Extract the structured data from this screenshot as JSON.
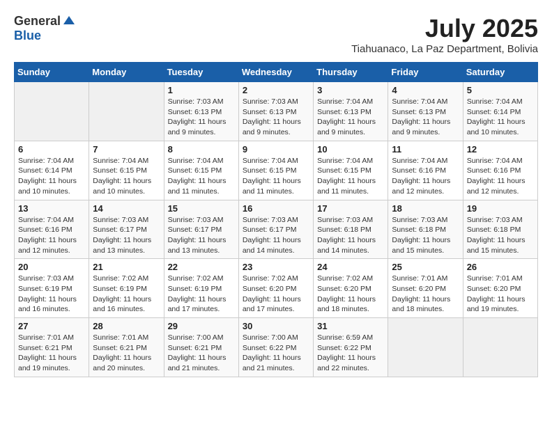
{
  "logo": {
    "general": "General",
    "blue": "Blue"
  },
  "title": {
    "month": "July 2025",
    "location": "Tiahuanaco, La Paz Department, Bolivia"
  },
  "headers": [
    "Sunday",
    "Monday",
    "Tuesday",
    "Wednesday",
    "Thursday",
    "Friday",
    "Saturday"
  ],
  "weeks": [
    [
      {
        "day": "",
        "empty": true
      },
      {
        "day": "",
        "empty": true
      },
      {
        "day": "1",
        "sunrise": "7:03 AM",
        "sunset": "6:13 PM",
        "daylight": "11 hours and 9 minutes."
      },
      {
        "day": "2",
        "sunrise": "7:03 AM",
        "sunset": "6:13 PM",
        "daylight": "11 hours and 9 minutes."
      },
      {
        "day": "3",
        "sunrise": "7:04 AM",
        "sunset": "6:13 PM",
        "daylight": "11 hours and 9 minutes."
      },
      {
        "day": "4",
        "sunrise": "7:04 AM",
        "sunset": "6:13 PM",
        "daylight": "11 hours and 9 minutes."
      },
      {
        "day": "5",
        "sunrise": "7:04 AM",
        "sunset": "6:14 PM",
        "daylight": "11 hours and 10 minutes."
      }
    ],
    [
      {
        "day": "6",
        "sunrise": "7:04 AM",
        "sunset": "6:14 PM",
        "daylight": "11 hours and 10 minutes."
      },
      {
        "day": "7",
        "sunrise": "7:04 AM",
        "sunset": "6:15 PM",
        "daylight": "11 hours and 10 minutes."
      },
      {
        "day": "8",
        "sunrise": "7:04 AM",
        "sunset": "6:15 PM",
        "daylight": "11 hours and 11 minutes."
      },
      {
        "day": "9",
        "sunrise": "7:04 AM",
        "sunset": "6:15 PM",
        "daylight": "11 hours and 11 minutes."
      },
      {
        "day": "10",
        "sunrise": "7:04 AM",
        "sunset": "6:15 PM",
        "daylight": "11 hours and 11 minutes."
      },
      {
        "day": "11",
        "sunrise": "7:04 AM",
        "sunset": "6:16 PM",
        "daylight": "11 hours and 12 minutes."
      },
      {
        "day": "12",
        "sunrise": "7:04 AM",
        "sunset": "6:16 PM",
        "daylight": "11 hours and 12 minutes."
      }
    ],
    [
      {
        "day": "13",
        "sunrise": "7:04 AM",
        "sunset": "6:16 PM",
        "daylight": "11 hours and 12 minutes."
      },
      {
        "day": "14",
        "sunrise": "7:03 AM",
        "sunset": "6:17 PM",
        "daylight": "11 hours and 13 minutes."
      },
      {
        "day": "15",
        "sunrise": "7:03 AM",
        "sunset": "6:17 PM",
        "daylight": "11 hours and 13 minutes."
      },
      {
        "day": "16",
        "sunrise": "7:03 AM",
        "sunset": "6:17 PM",
        "daylight": "11 hours and 14 minutes."
      },
      {
        "day": "17",
        "sunrise": "7:03 AM",
        "sunset": "6:18 PM",
        "daylight": "11 hours and 14 minutes."
      },
      {
        "day": "18",
        "sunrise": "7:03 AM",
        "sunset": "6:18 PM",
        "daylight": "11 hours and 15 minutes."
      },
      {
        "day": "19",
        "sunrise": "7:03 AM",
        "sunset": "6:18 PM",
        "daylight": "11 hours and 15 minutes."
      }
    ],
    [
      {
        "day": "20",
        "sunrise": "7:03 AM",
        "sunset": "6:19 PM",
        "daylight": "11 hours and 16 minutes."
      },
      {
        "day": "21",
        "sunrise": "7:02 AM",
        "sunset": "6:19 PM",
        "daylight": "11 hours and 16 minutes."
      },
      {
        "day": "22",
        "sunrise": "7:02 AM",
        "sunset": "6:19 PM",
        "daylight": "11 hours and 17 minutes."
      },
      {
        "day": "23",
        "sunrise": "7:02 AM",
        "sunset": "6:20 PM",
        "daylight": "11 hours and 17 minutes."
      },
      {
        "day": "24",
        "sunrise": "7:02 AM",
        "sunset": "6:20 PM",
        "daylight": "11 hours and 18 minutes."
      },
      {
        "day": "25",
        "sunrise": "7:01 AM",
        "sunset": "6:20 PM",
        "daylight": "11 hours and 18 minutes."
      },
      {
        "day": "26",
        "sunrise": "7:01 AM",
        "sunset": "6:20 PM",
        "daylight": "11 hours and 19 minutes."
      }
    ],
    [
      {
        "day": "27",
        "sunrise": "7:01 AM",
        "sunset": "6:21 PM",
        "daylight": "11 hours and 19 minutes."
      },
      {
        "day": "28",
        "sunrise": "7:01 AM",
        "sunset": "6:21 PM",
        "daylight": "11 hours and 20 minutes."
      },
      {
        "day": "29",
        "sunrise": "7:00 AM",
        "sunset": "6:21 PM",
        "daylight": "11 hours and 21 minutes."
      },
      {
        "day": "30",
        "sunrise": "7:00 AM",
        "sunset": "6:22 PM",
        "daylight": "11 hours and 21 minutes."
      },
      {
        "day": "31",
        "sunrise": "6:59 AM",
        "sunset": "6:22 PM",
        "daylight": "11 hours and 22 minutes."
      },
      {
        "day": "",
        "empty": true
      },
      {
        "day": "",
        "empty": true
      }
    ]
  ],
  "labels": {
    "sunrise_prefix": "Sunrise: ",
    "sunset_prefix": "Sunset: ",
    "daylight_prefix": "Daylight: "
  }
}
